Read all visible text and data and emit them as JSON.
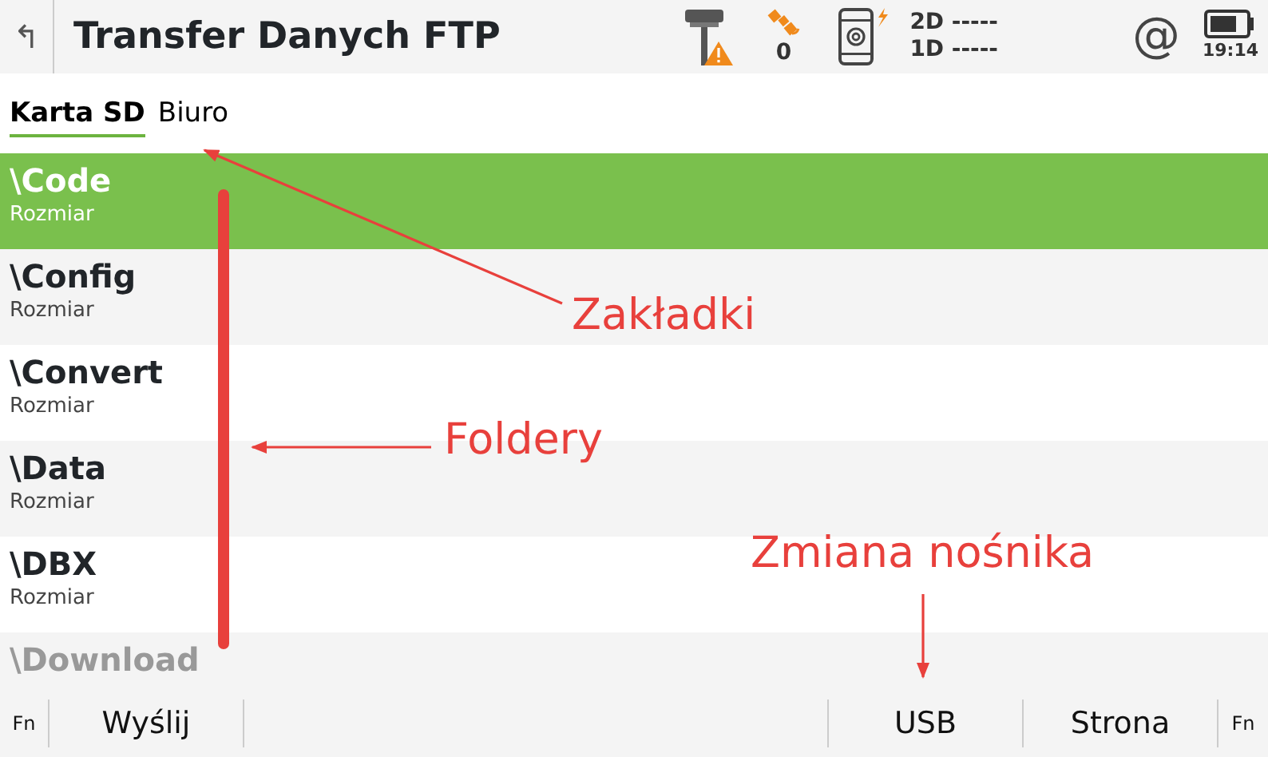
{
  "header": {
    "back": "↰",
    "title": "Transfer Danych FTP",
    "satellites": "0",
    "quality_2d": "2D -----",
    "quality_1d": "1D -----",
    "at": "@",
    "time": "19:14"
  },
  "tabs": [
    {
      "label": "Karta SD",
      "selected": true
    },
    {
      "label": "Biuro",
      "selected": false
    }
  ],
  "folders": [
    {
      "name": "\\Code",
      "size": "Rozmiar",
      "selected": true
    },
    {
      "name": "\\Config",
      "size": "Rozmiar",
      "selected": false
    },
    {
      "name": "\\Convert",
      "size": "Rozmiar",
      "selected": false
    },
    {
      "name": "\\Data",
      "size": "Rozmiar",
      "selected": false
    },
    {
      "name": "\\DBX",
      "size": "Rozmiar",
      "selected": false
    },
    {
      "name": "\\Download",
      "selected": false
    }
  ],
  "softkeys": [
    {
      "label": "Fn",
      "kind": "fn"
    },
    {
      "label": "Wyślij",
      "kind": "key"
    },
    {
      "kind": "blank"
    },
    {
      "label": "USB",
      "kind": "key"
    },
    {
      "label": "Strona",
      "kind": "key"
    },
    {
      "label": "Fn",
      "kind": "fn"
    }
  ],
  "annotations": [
    {
      "text": "Zakładki",
      "kind": "tabs"
    },
    {
      "text": "Foldery",
      "kind": "folders"
    },
    {
      "text": "Zmiana nośnika",
      "kind": "media"
    }
  ]
}
